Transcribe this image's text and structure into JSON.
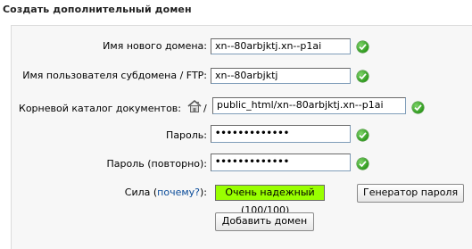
{
  "page": {
    "title": "Создать дополнительный домен"
  },
  "form": {
    "new_domain": {
      "label": "Имя нового домена:",
      "value": "xn--80arbjktj.xn--p1ai"
    },
    "subdomain_ftp": {
      "label": "Имя пользователя субдомена / FTP:",
      "value": "xn--80arbjktj"
    },
    "docroot": {
      "label": "Корневой каталог документов:",
      "separator": "/",
      "value": "public_html/xn--80arbjktj.xn--p1ai"
    },
    "password": {
      "label": "Пароль:",
      "value": "•••••••••••••"
    },
    "password_confirm": {
      "label": "Пароль (повторно):",
      "value": "•••••••••••••"
    },
    "strength": {
      "label_prefix": "Сила (",
      "link": "почему?",
      "label_suffix": "):",
      "value_text": "Очень надежный",
      "score_text": "(100/100)",
      "score": 100,
      "color": "#99ff00"
    },
    "generator_button": "Генератор пароля",
    "submit_button": "Добавить домен"
  },
  "icons": {
    "valid": "check-circle-icon",
    "home": "home-icon"
  },
  "colors": {
    "valid": "#2f9a1e",
    "link": "#0b4c9a"
  }
}
